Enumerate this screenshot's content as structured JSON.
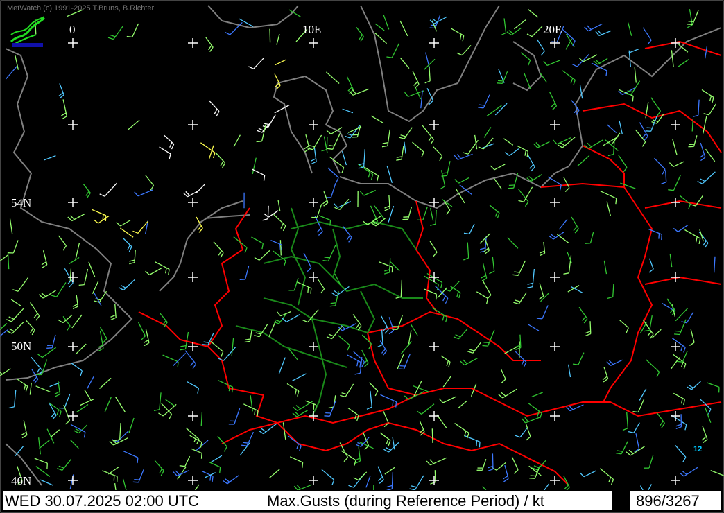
{
  "header": {
    "copyright": "MetWatch  (c) 1991-2025 T.Bruns, B.Richter"
  },
  "longitude_labels": [
    "0",
    "10E",
    "20E"
  ],
  "latitude_labels": [
    "54N",
    "50N",
    "46N"
  ],
  "footer": {
    "datetime": "WED 30.07.2025 02:00 UTC",
    "title": "Max.Gusts (during Reference Period) / kt",
    "count": "896/3267"
  },
  "station_mark": "12",
  "colors": {
    "background": "#000000",
    "coastline": "#808080",
    "border": "#ff0000",
    "state_border": "#1a8a1a",
    "grid_cross": "#ffffff",
    "barb_light": "#32c832",
    "barb_green": "#96ff6e",
    "barb_blue": "#3c78ff",
    "barb_cyan": "#50c8ff",
    "barb_white": "#ffffff",
    "barb_yellow": "#ffff50"
  }
}
